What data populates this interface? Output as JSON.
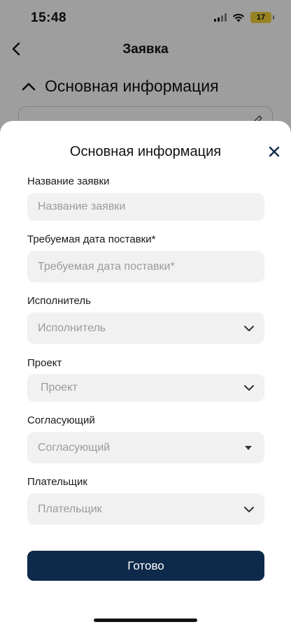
{
  "status_bar": {
    "time": "15:48",
    "battery": "17"
  },
  "nav": {
    "title": "Заявка"
  },
  "background_section": {
    "title": "Основная информация"
  },
  "sheet": {
    "title": "Основная информация",
    "fields": [
      {
        "label": "Название заявки",
        "placeholder": "Название заявки",
        "kind": "text"
      },
      {
        "label": "Требуемая дата поставки*",
        "placeholder": "Требуемая дата поставки*",
        "kind": "text"
      },
      {
        "label": "Исполнитель",
        "placeholder": "Исполнитель",
        "kind": "select",
        "icon": "chevron-down-icon"
      },
      {
        "label": "Проект",
        "placeholder": "Проект",
        "kind": "select",
        "icon": "chevron-down-icon"
      },
      {
        "label": "Согласующий",
        "placeholder": "Согласующий",
        "kind": "select",
        "icon": "caret-down-icon"
      },
      {
        "label": "Плательщик",
        "placeholder": "Плательщик",
        "kind": "select",
        "icon": "chevron-down-icon"
      }
    ],
    "done_label": "Готово"
  },
  "colors": {
    "primary": "#0e2a4a",
    "field_bg": "#f1f1f1",
    "placeholder": "#9b9b9b",
    "battery": "#f4d43a"
  }
}
